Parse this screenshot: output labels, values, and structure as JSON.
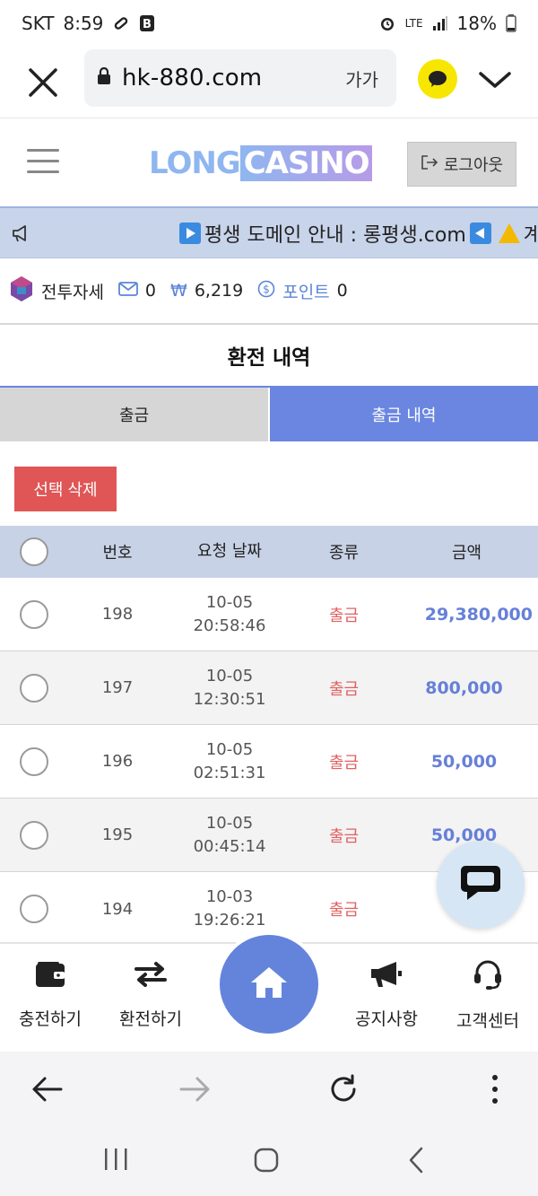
{
  "status_bar": {
    "carrier": "SKT",
    "time": "8:59",
    "network": "LTE",
    "battery": "18%"
  },
  "browser": {
    "url": "hk-880.com",
    "text_size_label": "가가"
  },
  "site": {
    "logo_part1": "LONG",
    "logo_part2": "CASINO",
    "logout_label": "로그아웃",
    "notice_text": "평생 도메인 안내 : 롱평생.com",
    "notice_text_2": "계좌"
  },
  "user": {
    "nickname": "전투자세",
    "messages": "0",
    "balance_symbol": "₩",
    "balance": "6,219",
    "points_label": "포인트",
    "points": "0"
  },
  "page": {
    "title": "환전 내역",
    "tabs": [
      {
        "label": "출금"
      },
      {
        "label": "출금 내역"
      }
    ],
    "delete_button": "선택 삭제"
  },
  "table": {
    "headers": {
      "no": "번호",
      "date": "요청 날짜",
      "type": "종류",
      "amount": "금액"
    },
    "rows": [
      {
        "no": "198",
        "date": "10-05",
        "time": "20:58:46",
        "type": "출금",
        "amount": "29,380,000"
      },
      {
        "no": "197",
        "date": "10-05",
        "time": "12:30:51",
        "type": "출금",
        "amount": "800,000"
      },
      {
        "no": "196",
        "date": "10-05",
        "time": "02:51:31",
        "type": "출금",
        "amount": "50,000"
      },
      {
        "no": "195",
        "date": "10-05",
        "time": "00:45:14",
        "type": "출금",
        "amount": "50,000"
      },
      {
        "no": "194",
        "date": "10-03",
        "time": "19:26:21",
        "type": "출금",
        "amount": ""
      }
    ]
  },
  "bottom_nav": {
    "charge": "충전하기",
    "exchange": "환전하기",
    "notice": "공지사항",
    "support": "고객센터"
  },
  "colors": {
    "accent": "#6a86e0",
    "danger": "#e05555",
    "withdraw_red": "#e06161",
    "amount_blue": "#6680d8",
    "notice_bg": "#c8d4ea",
    "kakao_yellow": "#f7e600"
  }
}
